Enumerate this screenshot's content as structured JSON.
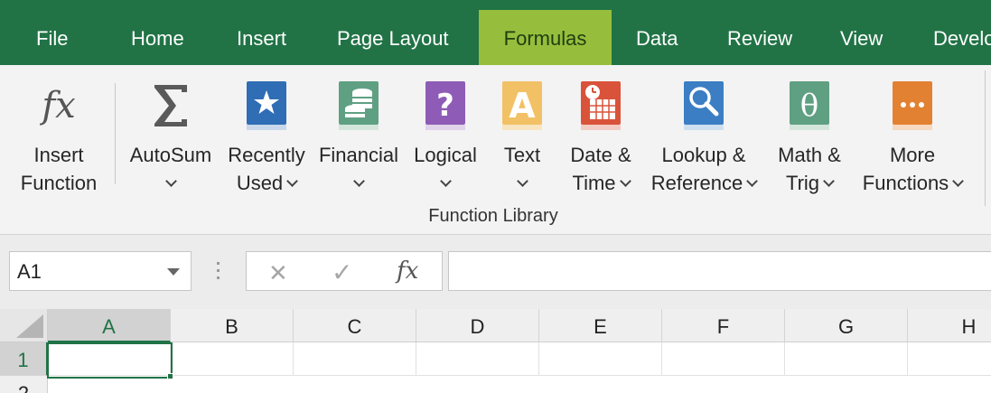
{
  "tabs": [
    {
      "label": "File"
    },
    {
      "label": "Home"
    },
    {
      "label": "Insert"
    },
    {
      "label": "Page Layout"
    },
    {
      "label": "Formulas",
      "active": true
    },
    {
      "label": "Data"
    },
    {
      "label": "Review"
    },
    {
      "label": "View"
    },
    {
      "label": "Develo"
    }
  ],
  "ribbon": {
    "insert_function": {
      "line1": "Insert",
      "line2": "Function",
      "icon": "fx-icon"
    },
    "autosum": {
      "line1": "AutoSum",
      "icon": "sigma-icon"
    },
    "recently_used": {
      "line1": "Recently",
      "line2": "Used",
      "icon": "star-book-icon"
    },
    "financial": {
      "line1": "Financial",
      "icon": "coins-book-icon"
    },
    "logical": {
      "line1": "Logical",
      "icon": "question-book-icon"
    },
    "text": {
      "line1": "Text",
      "icon": "letter-a-book-icon"
    },
    "date_time": {
      "line1": "Date &",
      "line2": "Time",
      "icon": "calendar-book-icon"
    },
    "lookup_reference": {
      "line1": "Lookup &",
      "line2": "Reference",
      "icon": "magnifier-book-icon"
    },
    "math_trig": {
      "line1": "Math &",
      "line2": "Trig",
      "icon": "theta-book-icon"
    },
    "more_functions": {
      "line1": "More",
      "line2": "Functions",
      "icon": "ellipsis-book-icon"
    },
    "group_label": "Function Library"
  },
  "formula_bar": {
    "name_box": "A1",
    "cancel_glyph": "✕",
    "enter_glyph": "✓",
    "fx_glyph": "fx",
    "formula": ""
  },
  "colors": {
    "brand": "#217346",
    "active_tab": "#96be3c",
    "fx_blue_book": "#2f6db5",
    "financial_book": "#5fa083",
    "logical_book": "#8e5cb6",
    "text_book": "#f2c165",
    "date_book": "#d9533a",
    "lookup_book": "#3b7ec4",
    "math_book": "#5fa083",
    "more_book": "#e38132"
  },
  "sheet": {
    "columns": [
      "A",
      "B",
      "C",
      "D",
      "E",
      "F",
      "G",
      "H"
    ],
    "rows": [
      "1",
      "2"
    ],
    "active_cell": "A1"
  }
}
